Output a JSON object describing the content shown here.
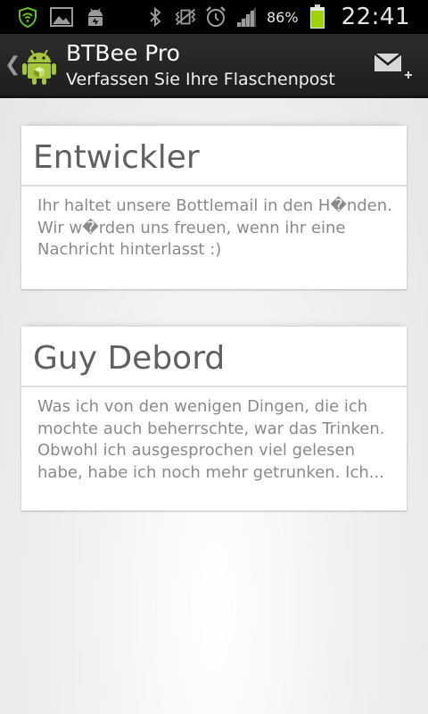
{
  "status_bar": {
    "battery_percent": "86%",
    "time": "22:41",
    "icons": [
      "shield-icon",
      "image-icon",
      "android-debug-icon",
      "bluetooth-icon",
      "vibrate-icon",
      "alarm-icon",
      "signal-icon",
      "battery-icon"
    ],
    "battery_color": "#9fd400"
  },
  "action_bar": {
    "title": "BTBee Pro",
    "subtitle": "Verfassen Sie Ihre Flaschenpost",
    "compose_icon": "compose-mail-icon"
  },
  "messages": [
    {
      "author": "Entwickler",
      "text": "Ihr haltet unsere Bottlemail in den H�nden. Wir w�rden uns freuen, wenn ihr eine Nachricht hinterlasst :)"
    },
    {
      "author": "Guy Debord",
      "text": "Was ich von den wenigen Dingen, die ich mochte auch beherrschte, war das Trinken. Obwohl ich ausgesprochen viel gelesen habe, habe ich noch mehr getrunken. Ich..."
    }
  ]
}
